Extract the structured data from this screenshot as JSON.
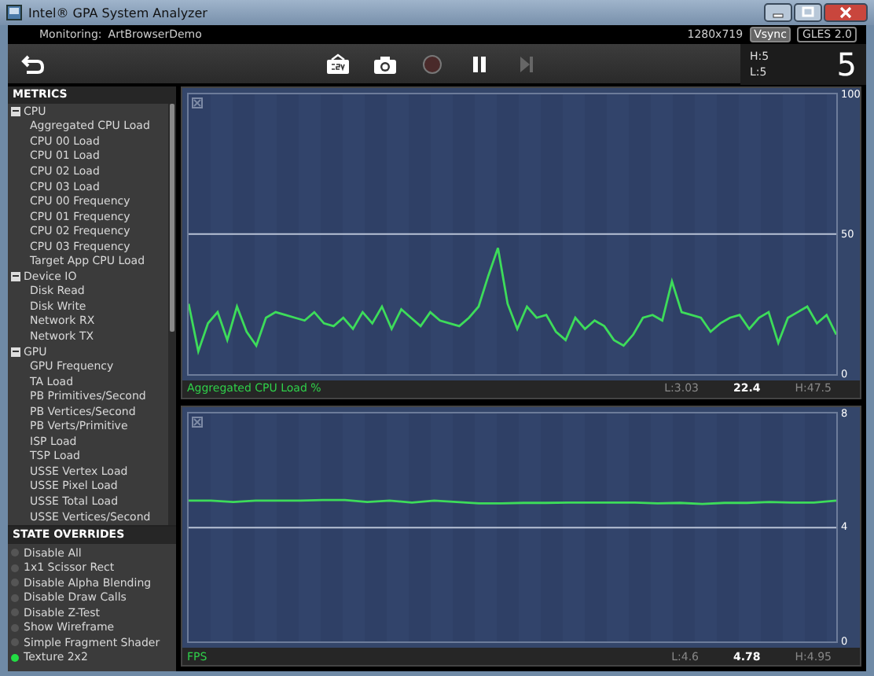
{
  "window": {
    "title": "Intel® GPA System Analyzer"
  },
  "header": {
    "monitoring_label": "Monitoring:",
    "app": "ArtBrowserDemo",
    "resolution": "1280x719",
    "badges": [
      "Vsync",
      "GLES 2.0"
    ]
  },
  "toolbar": {
    "buttons": [
      {
        "kind": "csv",
        "disabled": false
      },
      {
        "kind": "camera",
        "disabled": false
      },
      {
        "kind": "record",
        "disabled": true
      },
      {
        "kind": "pause",
        "disabled": false
      },
      {
        "kind": "step",
        "disabled": true
      }
    ],
    "fps_high": "H:5",
    "fps_low": "L:5",
    "fps": "5"
  },
  "sidebar": {
    "metrics_title": "METRICS",
    "metrics": [
      {
        "label": "CPU",
        "expanded": true,
        "children": [
          {
            "label": "Aggregated CPU Load"
          },
          {
            "label": "CPU 00 Load"
          },
          {
            "label": "CPU 01 Load"
          },
          {
            "label": "CPU 02 Load"
          },
          {
            "label": "CPU 03 Load"
          },
          {
            "label": "CPU 00 Frequency"
          },
          {
            "label": "CPU 01 Frequency"
          },
          {
            "label": "CPU 02 Frequency"
          },
          {
            "label": "CPU 03 Frequency"
          },
          {
            "label": "Target App CPU Load"
          }
        ]
      },
      {
        "label": "Device IO",
        "expanded": true,
        "children": [
          {
            "label": "Disk Read"
          },
          {
            "label": "Disk Write"
          },
          {
            "label": "Network RX"
          },
          {
            "label": "Network TX"
          }
        ]
      },
      {
        "label": "GPU",
        "expanded": true,
        "children": [
          {
            "label": "GPU Frequency"
          },
          {
            "label": "TA Load"
          },
          {
            "label": "PB Primitives/Second"
          },
          {
            "label": "PB Vertices/Second"
          },
          {
            "label": "PB Verts/Primitive"
          },
          {
            "label": "ISP Load"
          },
          {
            "label": "TSP Load"
          },
          {
            "label": "USSE Vertex Load"
          },
          {
            "label": "USSE Pixel Load"
          },
          {
            "label": "USSE Total Load"
          },
          {
            "label": "USSE Vertices/Second"
          }
        ]
      }
    ],
    "overrides_title": "STATE OVERRIDES",
    "overrides": [
      {
        "label": "Disable All",
        "on": false
      },
      {
        "label": "1x1 Scissor Rect",
        "on": false
      },
      {
        "label": "Disable Alpha Blending",
        "on": false
      },
      {
        "label": "Disable Draw Calls",
        "on": false
      },
      {
        "label": "Disable Z-Test",
        "on": false
      },
      {
        "label": "Show Wireframe",
        "on": false
      },
      {
        "label": "Simple Fragment Shader",
        "on": false
      },
      {
        "label": "Texture 2x2",
        "on": true
      }
    ]
  },
  "charts": [
    {
      "low": "L:3.03",
      "current": "22.4",
      "high": "H:47.5",
      "chart_data": {
        "type": "line",
        "ylim": [
          0,
          100
        ],
        "yticks": [
          0,
          50,
          100
        ],
        "series": [
          {
            "name": "Aggregated CPU Load %",
            "color": "#3ddc5a",
            "values": [
              25,
              8,
              18,
              22,
              12,
              24,
              15,
              10,
              20,
              22,
              21,
              20,
              19,
              22,
              18,
              17,
              20,
              16,
              22,
              18,
              24,
              16,
              23,
              20,
              17,
              22,
              19,
              18,
              17,
              20,
              24,
              35,
              45,
              25,
              16,
              24,
              20,
              21,
              15,
              12,
              20,
              16,
              19,
              17,
              12,
              10,
              14,
              20,
              21,
              19,
              33,
              22,
              21,
              20,
              15,
              18,
              20,
              21,
              16,
              20,
              22,
              11,
              20,
              22,
              24,
              18,
              21,
              14
            ]
          }
        ]
      }
    },
    {
      "low": "L:4.6",
      "current": "4.78",
      "high": "H:4.95",
      "chart_data": {
        "type": "line",
        "ylim": [
          0,
          8
        ],
        "yticks": [
          0,
          4,
          8
        ],
        "series": [
          {
            "name": "FPS",
            "color": "#3ddc5a",
            "values": [
              4.95,
              4.95,
              4.9,
              4.95,
              4.95,
              4.95,
              4.97,
              4.97,
              4.9,
              4.95,
              4.88,
              4.95,
              4.9,
              4.85,
              4.85,
              4.87,
              4.87,
              4.88,
              4.88,
              4.88,
              4.88,
              4.85,
              4.87,
              4.83,
              4.87,
              4.87,
              4.9,
              4.88,
              4.88,
              4.95
            ]
          }
        ]
      }
    }
  ]
}
